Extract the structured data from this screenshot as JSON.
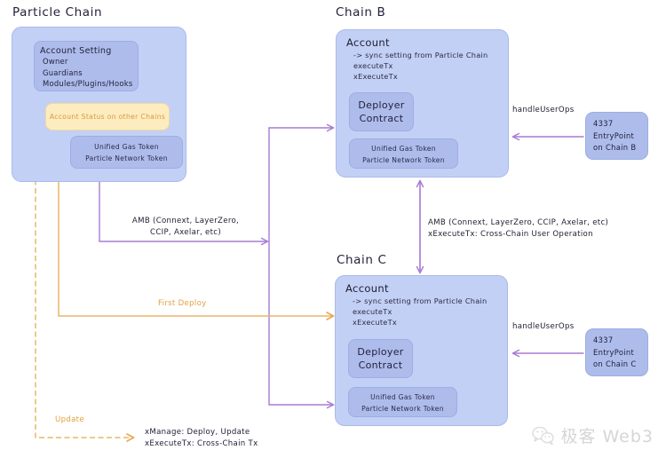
{
  "diagram": {
    "title": "Particle Chain Cross-Chain Account Abstraction Diagram",
    "colors": {
      "chain_box_fill": "#c3d0f5",
      "inner_card_fill": "#aebcec",
      "yellow_card_fill": "#fcecc0",
      "yellow_text": "#d79a3c",
      "purple_edge": "#a77bd4",
      "orange_edge": "#e8b66a",
      "text": "#22223a"
    }
  },
  "particle_chain": {
    "title": "Particle Chain",
    "account_setting": {
      "heading": "Account Setting",
      "items": [
        "Owner",
        "Guardians",
        "Modules/Plugins/Hooks"
      ]
    },
    "account_status": {
      "label": "Account Status on other Chains"
    },
    "tokens": {
      "line1": "Unified Gas Token",
      "line2": "Particle Network Token"
    }
  },
  "chain_b": {
    "title": "Chain B",
    "account": {
      "heading": "Account",
      "lines": [
        "-> sync setting from Particle Chain",
        "executeTx",
        "xExecuteTx"
      ]
    },
    "deployer": {
      "line1": "Deployer",
      "line2": "Contract"
    },
    "tokens": {
      "line1": "Unified Gas Token",
      "line2": "Particle Network Token"
    },
    "entrypoint": {
      "line1": "4337",
      "line2": "EntryPoint",
      "line3": "on Chain B"
    },
    "handle_user_ops_label": "handleUserOps"
  },
  "chain_c": {
    "title": "Chain C",
    "account": {
      "heading": "Account",
      "lines": [
        "-> sync setting from Particle Chain",
        "executeTx",
        "xExecuteTx"
      ]
    },
    "deployer": {
      "line1": "Deployer",
      "line2": "Contract"
    },
    "tokens": {
      "line1": "Unified Gas Token",
      "line2": "Particle Network Token"
    },
    "entrypoint": {
      "line1": "4337",
      "line2": "EntryPoint",
      "line3": "on Chain C"
    },
    "handle_user_ops_label": "handleUserOps"
  },
  "edges": {
    "amb_left_line1": "AMB (Connext, LayerZero,",
    "amb_left_line2": "CCIP, Axelar, etc)",
    "amb_mid_line1": "AMB (Connext, LayerZero, CCIP, Axelar, etc)",
    "amb_mid_line2": "xExecuteTx: Cross-Chain User Operation",
    "first_deploy": "First Deploy",
    "update": "Update",
    "legend_line1": "xManage: Deploy, Update",
    "legend_line2": "xExecuteTx: Cross-Chain Tx"
  },
  "watermark": {
    "text": "极客 Web3",
    "icon": "wechat-icon"
  }
}
